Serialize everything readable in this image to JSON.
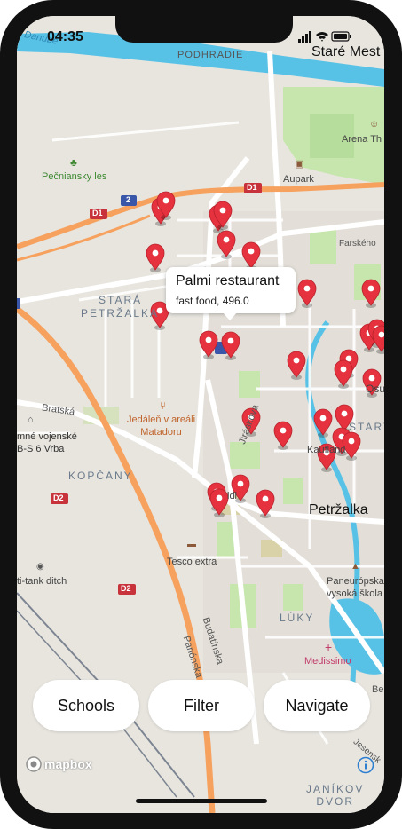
{
  "status_bar": {
    "time": "04:35"
  },
  "map": {
    "callout": {
      "title": "Palmi restaurant",
      "subtitle": "fast food, 496.0"
    },
    "labels": {
      "danube": "Danube",
      "podhradie": "PODHRADIE",
      "stare_mesto": "Staré Mest",
      "arena": "Arena Th",
      "aupark": "Aupark",
      "pecniansky_les": "Pečniansky les",
      "farskeho": "Farského",
      "stara": "STARÁ",
      "petrzalka_district": "PETRŽALKA",
      "osu": "Osu",
      "stary": "STARY",
      "bratska": "Bratská",
      "jedalen_line1": "Jedáleň v areáli",
      "jedalen_line2": "Matadoru",
      "vojenske_line1": "mné vojenské",
      "vojenske_line2": "B-S 6 Vrba",
      "jiraskova": "Jiráskova",
      "kaufland": "Kaufland",
      "kopcany": "KOPČANY",
      "petrzalka": "Petržalka",
      "tesco": "Tesco extra",
      "antitank": "ti-tank ditch",
      "paneuropska_line1": "Paneurópska",
      "paneuropska_line2": "vysoká škola",
      "luky": "LÚKY",
      "budatinska": "Budatínska",
      "panonska": "Panónska",
      "medissimo": "Medissimo",
      "janikov_line1": "JANÍKOV",
      "janikov_line2": "DVOR",
      "jesenskeho": "Jesensk",
      "be": "Be",
      "d1a": "D1",
      "d1b": "D1",
      "d2a": "D2",
      "d2b": "D2",
      "r2": "2",
      "idl": "idl"
    }
  },
  "buttons": {
    "schools": "Schools",
    "filter": "Filter",
    "navigate": "Navigate"
  },
  "attribution": {
    "logo_text": "mapbox"
  },
  "colors": {
    "water": "#58c2e6",
    "park": "#c6e6ad",
    "motorway": "#f6a15d",
    "road": "#ffffff",
    "pin": "#e5323e",
    "land": "#e8e5df"
  }
}
